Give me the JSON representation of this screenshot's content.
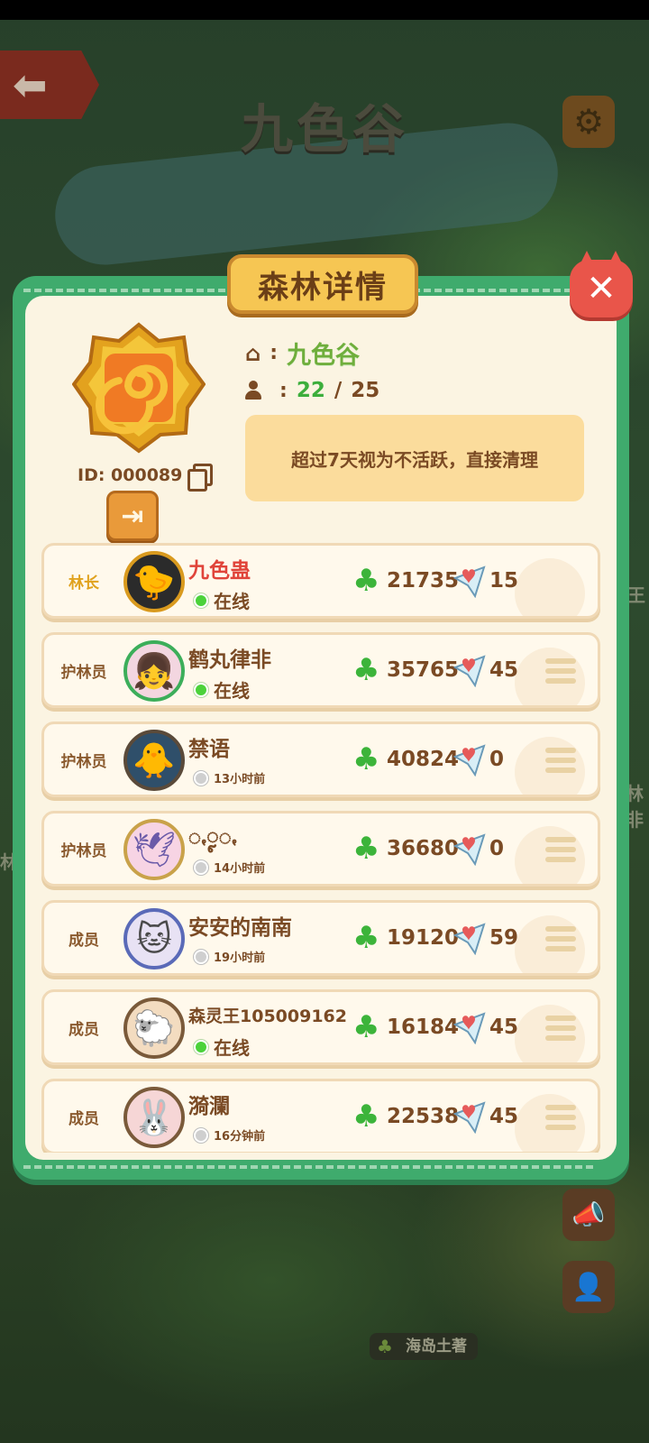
{
  "map": {
    "title": "九色谷",
    "back_icon": "arrow-left-icon",
    "settings_icon": "gear-icon",
    "island_label": "海岛土著",
    "edge_text_right_1": "王",
    "edge_text_right_2": "林非",
    "edge_text_left": "林"
  },
  "dialog": {
    "title": "森林详情",
    "close_icon": "close-icon",
    "forest": {
      "name": "九色谷",
      "id_label": "ID: 000089",
      "member_count": "22",
      "member_sep": "/",
      "member_max": "25",
      "notice": "超过7天视为不活跃，直接清理",
      "exit_icon": "exit-icon"
    },
    "colors": {
      "frame": "#3fab6d",
      "panel": "#fbf4e2",
      "text_brown": "#7a4a24",
      "online_green": "#4bd23a",
      "leader_gold": "#e0a21e",
      "leader_name_red": "#e0443a"
    }
  },
  "members": [
    {
      "role": "林长",
      "name": "九色蛊",
      "status": "在线",
      "online": true,
      "clover": "21735",
      "gifts": "15",
      "avatar_icon": "duck-sunglasses-avatar"
    },
    {
      "role": "护林员",
      "name": "鹤丸律非",
      "status": "在线",
      "online": true,
      "clover": "35765",
      "gifts": "45",
      "avatar_icon": "girl-avatar"
    },
    {
      "role": "护林员",
      "name": "禁语",
      "status": "13小时前",
      "online": false,
      "clover": "40824",
      "gifts": "0",
      "avatar_icon": "chick-avatar"
    },
    {
      "role": "护林员",
      "name": "ꩻꨵꩻ",
      "status": "14小时前",
      "online": false,
      "clover": "36680",
      "gifts": "0",
      "avatar_icon": "crane-avatar"
    },
    {
      "role": "成员",
      "name": "安安的南南",
      "status": "19小时前",
      "online": false,
      "clover": "19120",
      "gifts": "59",
      "avatar_icon": "cat-avatar"
    },
    {
      "role": "成员",
      "name": "森灵王105009162",
      "status": "在线",
      "online": true,
      "clover": "16184",
      "gifts": "45",
      "avatar_icon": "sheep-avatar"
    },
    {
      "role": "成员",
      "name": "漪瀾",
      "status": "16分钟前",
      "online": false,
      "clover": "22538",
      "gifts": "45",
      "avatar_icon": "rabbit-avatar"
    }
  ]
}
